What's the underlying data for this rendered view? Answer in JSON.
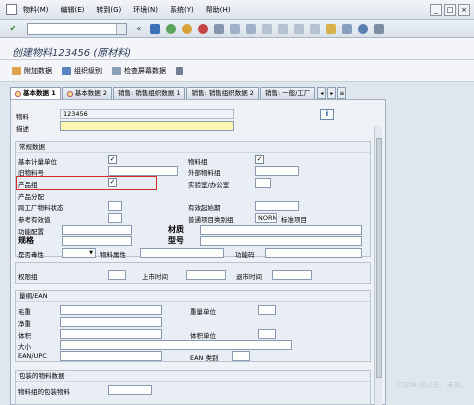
{
  "menubar": {
    "items": [
      "物料(M)",
      "编辑(E)",
      "转到(G)",
      "环境(N)",
      "系统(Y)",
      "帮助(H)"
    ]
  },
  "toolbar": {
    "back_label": "«"
  },
  "title": "创建物料123456 (原材料)",
  "app_toolbar": {
    "buttons": [
      "附加数据",
      "组织级别",
      "检查屏幕数据"
    ]
  },
  "tabs": [
    "基本数据 1",
    "基本数据 2",
    "销售: 销售组织数据 1",
    "销售: 销售组织数据 2",
    "销售: 一般/工厂"
  ],
  "header": {
    "material_label": "物料",
    "material_value": "123456",
    "desc_label": "描述",
    "desc_value": ""
  },
  "general": {
    "title": "常规数据",
    "base_uom": "基本计量单位",
    "old_material": "旧物料号",
    "division": "产品组",
    "product_alloc": "产品分配",
    "cross_plant_status": "跨工厂物料状态",
    "ref_valid": "参考有效值",
    "func_config": "功能配置",
    "spec": "规格",
    "haz": "是否毒性",
    "material_group": "物料组",
    "ext_material_group": "外部物料组",
    "lab_office": "实验室/办公室",
    "valid_from": "有效起始期",
    "gen_item_cat": "普通项目类别组",
    "gen_item_cat_value": "NORM",
    "gen_item_cat_text": "标准项目",
    "material_name": "材质",
    "model": "型号",
    "material_attr": "物料属性",
    "function_code": "功能码",
    "check_mark": "✓"
  },
  "rights": {
    "auth_group": "权限组",
    "launch_time": "上市时间",
    "exit_time": "退市时间"
  },
  "dims": {
    "title": "量纲/EAN",
    "gross_weight": "毛重",
    "net_weight": "净重",
    "volume": "体积",
    "size": "大小",
    "ean_upc": "EAN/UPC",
    "weight_unit": "重量单位",
    "volume_unit": "体积单位",
    "ean_category": "EAN 类别"
  },
  "packaging": {
    "title": "包装的物料数据",
    "mat_group_pack": "物料组的包装物料"
  },
  "watermark": "CSDN @过去、未来。"
}
